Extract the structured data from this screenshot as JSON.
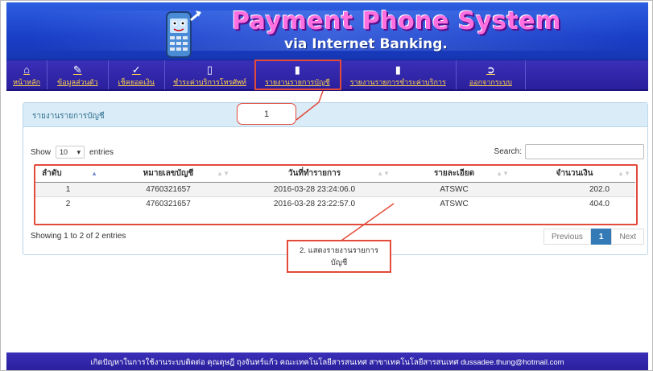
{
  "header": {
    "title": "Payment Phone System",
    "subtitle": "via Internet Banking."
  },
  "nav": {
    "items": [
      {
        "label": "หน้าหลัก",
        "icon": "home-icon"
      },
      {
        "label": "ข้อมูลส่วนตัว",
        "icon": "edit-icon"
      },
      {
        "label": "เช็คยอดเงิน",
        "icon": "check-icon"
      },
      {
        "label": "ชำระค่าบริการโทรศัพท์",
        "icon": "phone-icon"
      },
      {
        "label": "รายงานรายการบัญชี",
        "icon": "document-icon"
      },
      {
        "label": "รายงานรายการชำระค่าบริการ",
        "icon": "document-icon"
      },
      {
        "label": "ออกจากระบบ",
        "icon": "logout-icon"
      }
    ]
  },
  "panel": {
    "title": "รายงานรายการบัญชี",
    "show_label": "Show",
    "entries_value": "10",
    "entries_label": "entries",
    "search_label": "Search:",
    "columns": [
      "ลำดับ",
      "หมายเลขบัญชี",
      "วันที่ทำรายการ",
      "รายละเอียด",
      "จำนวนเงิน"
    ],
    "rows": [
      [
        "1",
        "4760321657",
        "2016-03-28 23:24:06.0",
        "ATSWC",
        "202.0"
      ],
      [
        "2",
        "4760321657",
        "2016-03-28 23:22:57.0",
        "ATSWC",
        "404.0"
      ]
    ],
    "info": "Showing 1 to 2 of 2 entries",
    "pager": {
      "previous": "Previous",
      "page": "1",
      "next": "Next"
    }
  },
  "callouts": {
    "one": "1",
    "two_line1": "2. แสดงรายงานรายการ",
    "two_line2": "บัญชี"
  },
  "footer": {
    "text": "เกิดปัญหาในการใช้งานระบบติดต่อ คุณดุษฎี ถุงจันทร์แก้ว คณะเทคโนโลยีสารสนเทศ สาขาเทคโนโลยีสารสนเทศ dussadee.thung@hotmail.com"
  },
  "colors": {
    "accent": "#e34a3a",
    "nav_bg": "#2a1f9c",
    "banner_bg": "#1a3ec8",
    "nav_text": "#ffd34a"
  }
}
